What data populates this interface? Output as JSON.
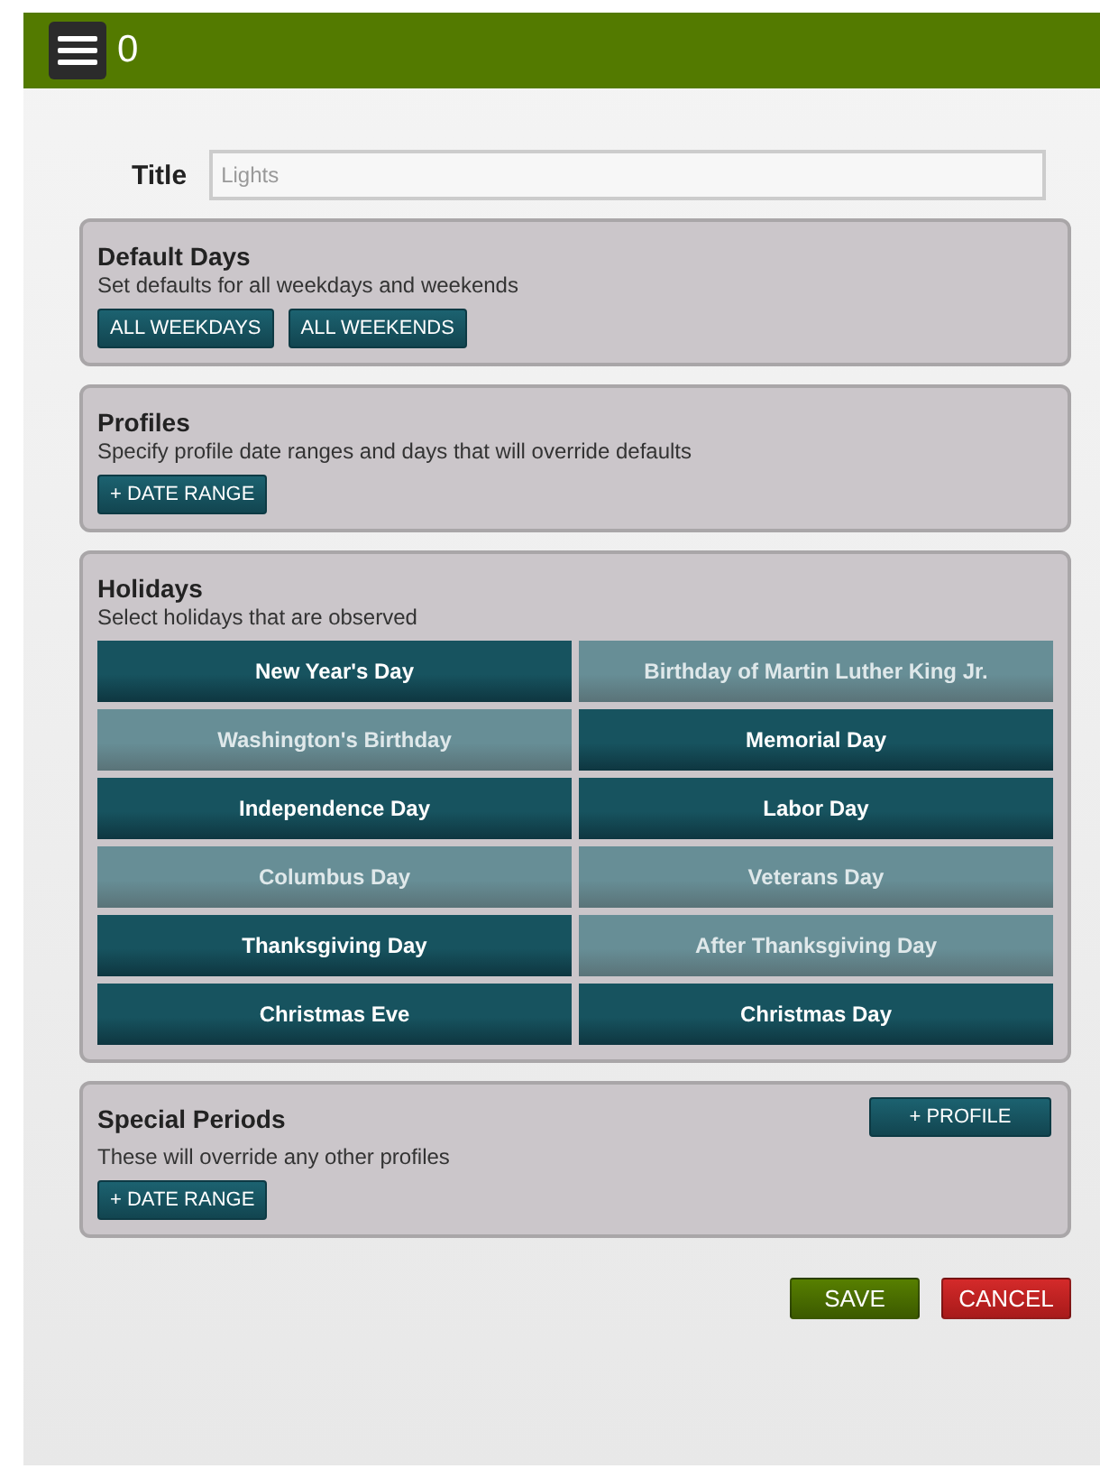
{
  "header": {
    "title": "0"
  },
  "title_field": {
    "label": "Title",
    "placeholder": "Lights"
  },
  "default_days": {
    "title": "Default Days",
    "description": "Set defaults for all weekdays and weekends",
    "buttons": [
      "ALL WEEKDAYS",
      "ALL WEEKENDS"
    ]
  },
  "profiles": {
    "title": "Profiles",
    "description": "Specify profile date ranges and days that will override defaults",
    "buttons": [
      "+ DATE RANGE"
    ]
  },
  "holidays": {
    "title": "Holidays",
    "description": "Select holidays that are observed",
    "items": [
      {
        "label": "New Year's Day",
        "selected": true
      },
      {
        "label": "Birthday of Martin Luther King Jr.",
        "selected": false
      },
      {
        "label": "Washington's Birthday",
        "selected": false
      },
      {
        "label": "Memorial Day",
        "selected": true
      },
      {
        "label": "Independence Day",
        "selected": true
      },
      {
        "label": "Labor Day",
        "selected": true
      },
      {
        "label": "Columbus Day",
        "selected": false
      },
      {
        "label": "Veterans Day",
        "selected": false
      },
      {
        "label": "Thanksgiving Day",
        "selected": true
      },
      {
        "label": "After Thanksgiving Day",
        "selected": false
      },
      {
        "label": "Christmas Eve",
        "selected": true
      },
      {
        "label": "Christmas Day",
        "selected": true
      }
    ]
  },
  "special_periods": {
    "title": "Special Periods",
    "action": "+ PROFILE",
    "description": "These will override any other profiles",
    "buttons": [
      "+ DATE RANGE"
    ]
  },
  "actions": [
    {
      "label": "SAVE",
      "kind": "save"
    },
    {
      "label": "CANCEL",
      "kind": "cancel"
    }
  ]
}
